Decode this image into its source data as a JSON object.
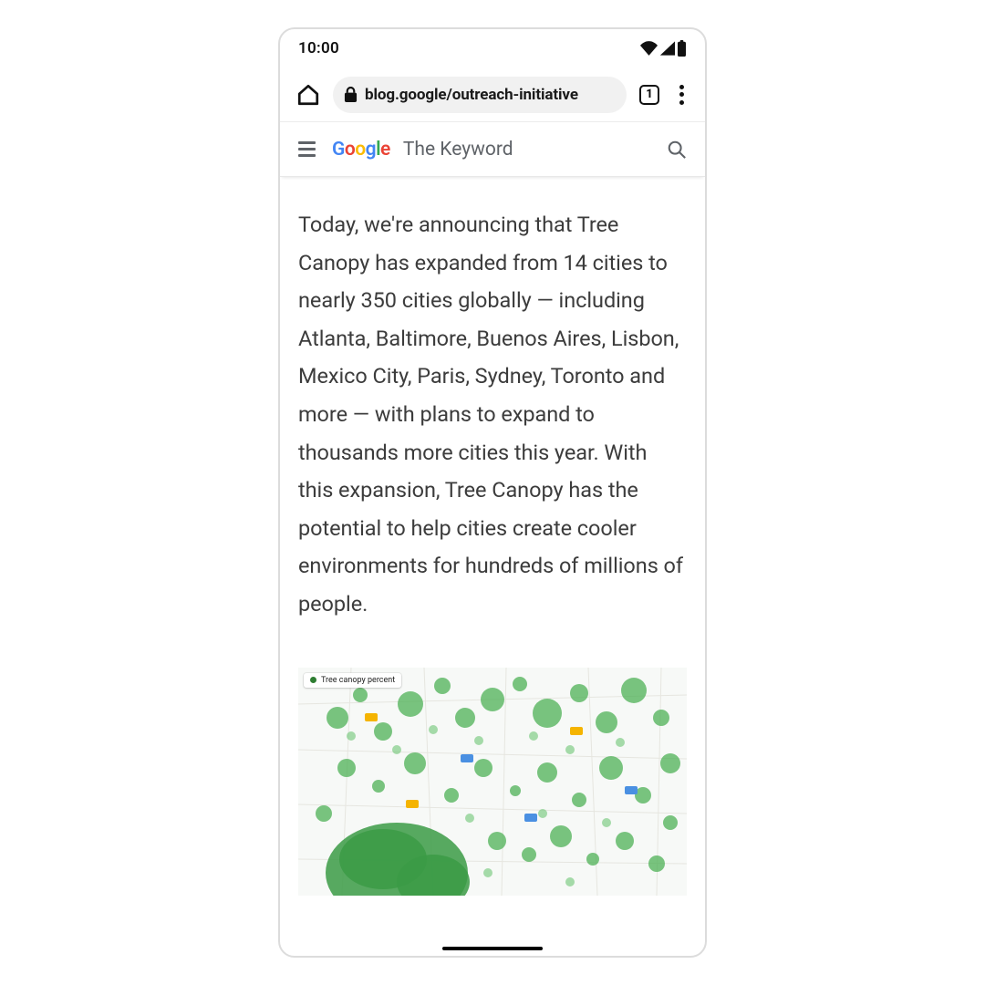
{
  "status": {
    "time": "10:00"
  },
  "chrome": {
    "url_display": "blog.google/outreach-initiative",
    "tab_count": "1"
  },
  "site_header": {
    "logo_letters": [
      "G",
      "o",
      "o",
      "g",
      "l",
      "e"
    ],
    "keyword_label": "The Keyword"
  },
  "article": {
    "body_text": "Today, we're announcing that Tree Canopy has expanded from 14 cities to nearly 350 cities globally — including Atlanta, Baltimore, Buenos Aires, Lisbon, Mexico City, Paris, Sydney, Toronto and more — with plans to expand to thousands more cities this year. With this expansion, Tree Canopy has the potential to help cities create cooler environments for hundreds of millions of people."
  },
  "map": {
    "legend_label": "Tree canopy percent"
  }
}
